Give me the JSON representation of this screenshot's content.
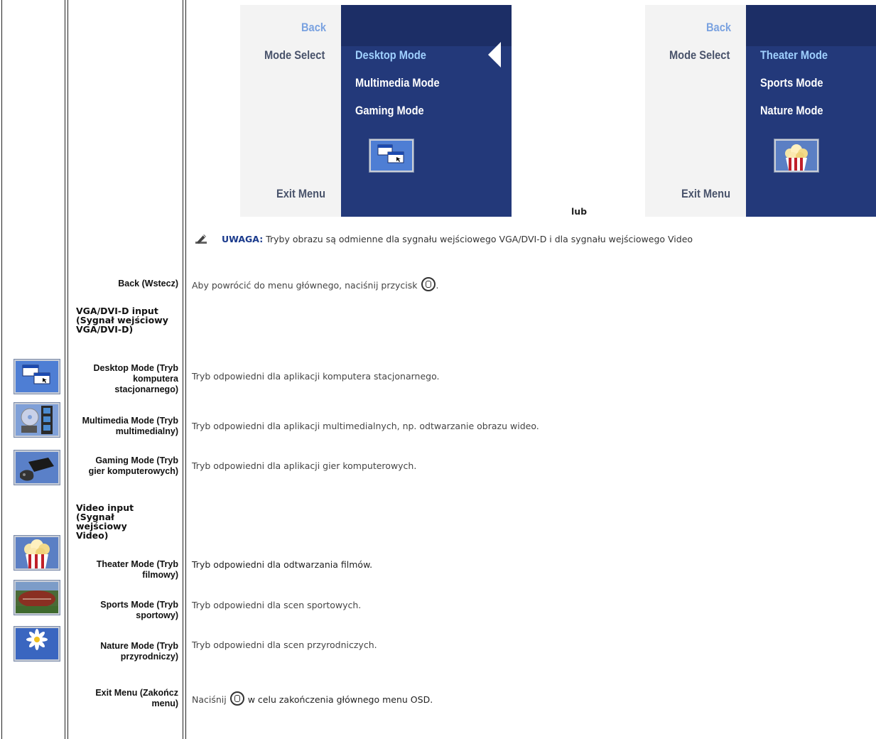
{
  "osd_panels": [
    {
      "left_items": {
        "back": "Back",
        "mode_select": "Mode Select",
        "exit": "Exit Menu"
      },
      "right_items": [
        "Desktop Mode",
        "Multimedia Mode",
        "Gaming Mode"
      ],
      "selected_index": 0,
      "icon": "desktop-windows-icon"
    },
    {
      "left_items": {
        "back": "Back",
        "mode_select": "Mode Select",
        "exit": "Exit Menu"
      },
      "right_items": [
        "Theater Mode",
        "Sports Mode",
        "Nature Mode"
      ],
      "selected_index": 0,
      "icon": "popcorn-icon"
    }
  ],
  "or_text": "lub",
  "note": {
    "label": "UWAGA:",
    "text": "Tryby obrazu są odmienne dla sygnału wejściowego VGA/DVI-D i dla sygnału wejściowego Video"
  },
  "rows": {
    "back": {
      "label": "Back (Wstecz)",
      "desc": "Aby powrócić do menu głównego, naciśnij przycisk",
      "desc_end": "."
    },
    "vga_group": {
      "label": "VGA/DVI-D input (Sygnał wejściowy VGA/DVI-D)"
    },
    "desktop": {
      "label": "Desktop Mode (Tryb komputera stacjonarnego)",
      "desc": "Tryb odpowiedni dla aplikacji komputera stacjonarnego."
    },
    "multimedia": {
      "label": "Multimedia Mode (Tryb multimedialny)",
      "desc": "Tryb odpowiedni dla aplikacji multimedialnych, np. odtwarzanie obrazu wideo."
    },
    "gaming": {
      "label": "Gaming Mode (Tryb gier komputerowych)",
      "desc": "Tryb odpowiedni dla aplikacji gier komputerowych."
    },
    "video_group": {
      "label": "Video input (Sygnał wejściowy Video)"
    },
    "theater": {
      "label": "Theater Mode (Tryb filmowy)",
      "desc": "Tryb odpowiedni dla odtwarzania filmów."
    },
    "sports": {
      "label": "Sports Mode (Tryb sportowy)",
      "desc": "Tryb odpowiedni dla scen sportowych."
    },
    "nature": {
      "label": "Nature Mode (Tryb przyrodniczy)",
      "desc": "Tryb odpowiedni dla scen przyrodniczych."
    },
    "exit": {
      "label": "Exit Menu (Zakończ menu)",
      "desc_pre": "Naciśnij",
      "desc": "w celu zakończenia głównego menu OSD."
    }
  },
  "icons": [
    "desktop-mode-icon",
    "multimedia-mode-icon",
    "gaming-mode-icon",
    "theater-mode-icon",
    "sports-mode-icon",
    "nature-mode-icon",
    "menu-button-icon",
    "note-pencil-icon"
  ],
  "colors": {
    "osd_blue": "#23397a",
    "osd_grey": "#f3f3f3",
    "note_label": "#1a3a8c"
  }
}
